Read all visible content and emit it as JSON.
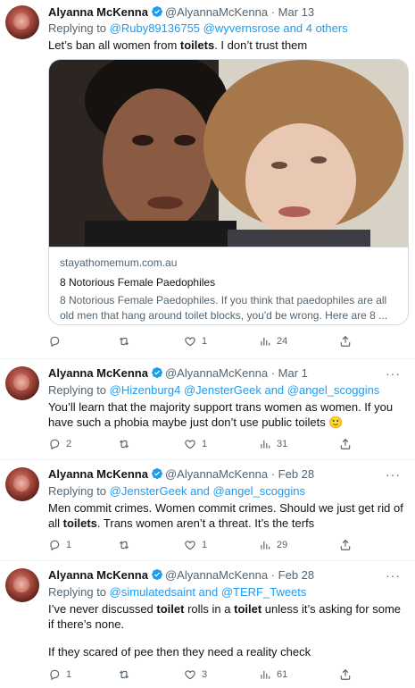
{
  "author": {
    "name": "Alyanna McKenna",
    "handle": "@AlyannaMcKenna"
  },
  "tweets": [
    {
      "date": "· Mar 13",
      "replying_to_prefix": "Replying to ",
      "replying_to": "@Ruby89136755 @wyvernsrose and 4 others",
      "text_parts": [
        "Let’s ban all women from ",
        "toilets",
        ". I don’t trust them"
      ],
      "card": {
        "domain": "stayathomemum.com.au",
        "title": "8 Notorious Female Paedophiles",
        "description": "8 Notorious Female Paedophiles. If you think that paedophiles are all old men that hang around toilet blocks, you'd be wrong. Here are 8 ..."
      },
      "stats": {
        "replies": "",
        "retweets": "",
        "likes": "1",
        "views": "24"
      }
    },
    {
      "date": "· Mar 1",
      "replying_to_prefix": "Replying to ",
      "replying_to": "@Hizenburg4 @JensterGeek and @angel_scoggins",
      "text_parts": [
        "You’ll learn that the majority support trans women as women. If you have such a phobia maybe just don’t use public toilets 🙂"
      ],
      "stats": {
        "replies": "2",
        "retweets": "",
        "likes": "1",
        "views": "31"
      }
    },
    {
      "date": "· Feb 28",
      "replying_to_prefix": "Replying to ",
      "replying_to": "@JensterGeek and @angel_scoggins",
      "text_parts": [
        "Men commit crimes. Women commit crimes. Should we just get rid of all ",
        "toilets",
        ". Trans women aren’t a threat. It’s the terfs"
      ],
      "stats": {
        "replies": "1",
        "retweets": "",
        "likes": "1",
        "views": "29"
      }
    },
    {
      "date": "· Feb 28",
      "replying_to_prefix": "Replying to ",
      "replying_to": "@simulatedsaint and @TERF_Tweets",
      "text_parts": [
        "I’ve never discussed ",
        "toilet",
        " rolls in a ",
        "toilet",
        " unless it’s asking for some if there’s none.",
        "If they scared of pee then they need a reality check"
      ],
      "stats": {
        "replies": "1",
        "retweets": "",
        "likes": "3",
        "views": "61"
      }
    }
  ],
  "more_label": "···",
  "colors": {
    "link": "#1d9bf0",
    "muted": "#536471",
    "verified": "#1d9bf0",
    "text": "#0f1419"
  },
  "icons": [
    "verified-badge-icon",
    "more-icon",
    "reply-icon",
    "retweet-icon",
    "like-icon",
    "views-icon",
    "share-icon"
  ]
}
